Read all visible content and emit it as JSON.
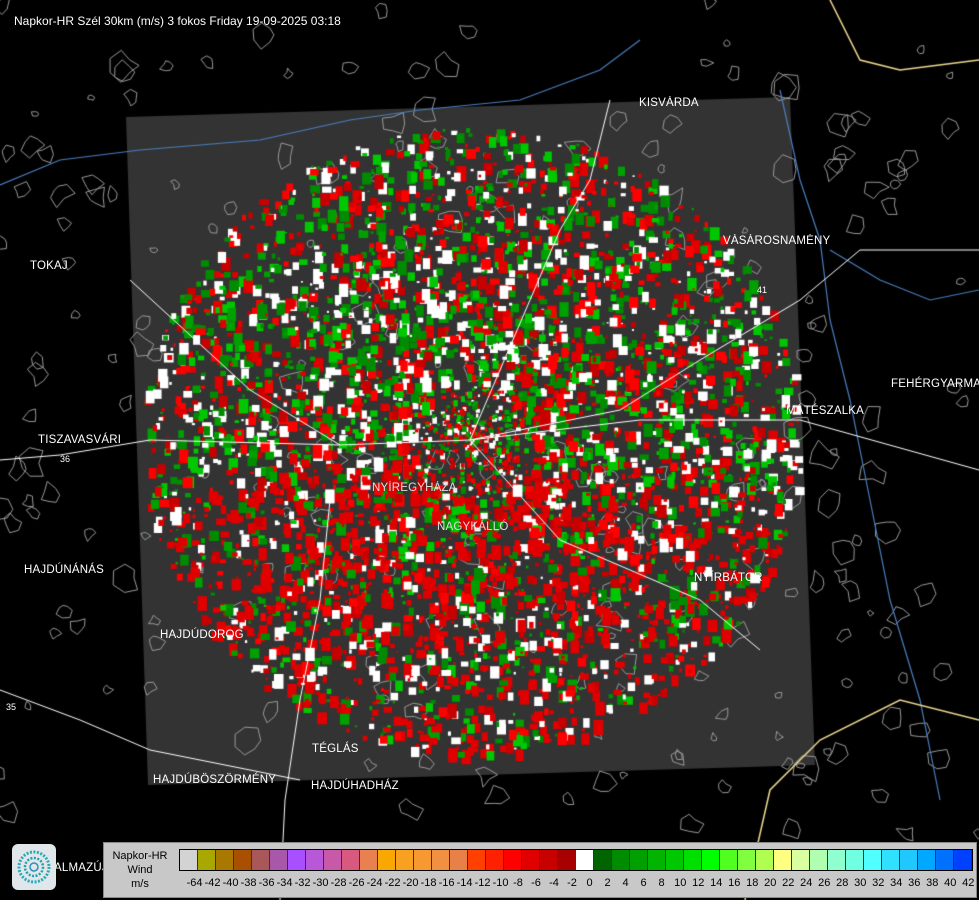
{
  "title": "Napkor-HR Szél 30km (m/s) 3 fokos Friday 19-09-2025 03:18",
  "cities": [
    {
      "name": "KISVÁRDA"
    },
    {
      "name": "VÁSÁROSNAMÉNY"
    },
    {
      "name": "FEHÉRGYARMAT"
    },
    {
      "name": "MÁTÉSZALKA"
    },
    {
      "name": "NYÍRBÁTOR"
    },
    {
      "name": "TOKAJ"
    },
    {
      "name": "TISZAVASVÁRI"
    },
    {
      "name": "HAJDÚNÁNÁS"
    },
    {
      "name": "HAJDÚDOROG"
    },
    {
      "name": "TÉGLÁS"
    },
    {
      "name": "HAJDÚBÖSZÖRMÉNY"
    },
    {
      "name": "HAJDÚHADHÁZ"
    },
    {
      "name": "NYÍREGYHÁZA"
    },
    {
      "name": "NAGYKÁLLÓ"
    },
    {
      "name": "ALMAZÚJVÁROS"
    }
  ],
  "roads": [
    "41",
    "36",
    "35"
  ],
  "legend": {
    "title_lines": [
      "Napkor-HR",
      "Wind",
      "m/s"
    ],
    "labels": [
      "-64",
      "-42",
      "-40",
      "-38",
      "-36",
      "-34",
      "-32",
      "-30",
      "-28",
      "-26",
      "-24",
      "-22",
      "-20",
      "-18",
      "-16",
      "-14",
      "-12",
      "-10",
      "-8",
      "-6",
      "-4",
      "-2",
      "0",
      "2",
      "4",
      "6",
      "8",
      "10",
      "12",
      "14",
      "16",
      "18",
      "20",
      "22",
      "24",
      "26",
      "28",
      "30",
      "32",
      "34",
      "36",
      "38",
      "40",
      "42"
    ],
    "colors": [
      "#d3d3d3",
      "#a8a800",
      "#a87800",
      "#a85000",
      "#a85858",
      "#a858a8",
      "#a850ff",
      "#b858d8",
      "#c858a8",
      "#d85880",
      "#e88050",
      "#f8a800",
      "#f8a020",
      "#f89830",
      "#f09040",
      "#e88048",
      "#ff4000",
      "#ff2000",
      "#ff0000",
      "#e00000",
      "#c80000",
      "#a80000",
      "#ffffff",
      "#006400",
      "#008c00",
      "#00a000",
      "#00b400",
      "#00c800",
      "#00e000",
      "#00ff00",
      "#50ff20",
      "#80ff40",
      "#b0ff50",
      "#ffff80",
      "#d8ffa0",
      "#b0ffb0",
      "#90ffd0",
      "#70ffe0",
      "#50ffff",
      "#30e0ff",
      "#20c8ff",
      "#00a8ff",
      "#0070ff",
      "#0040ff"
    ]
  },
  "colors": {
    "background": "#000000",
    "radar_area": "#333333",
    "rivers": "#4a7fc0",
    "roads": "#ffffff",
    "border": "#f0d890",
    "settlements": "#9a9a9a"
  },
  "logo_icon": "napkor-logo-icon"
}
